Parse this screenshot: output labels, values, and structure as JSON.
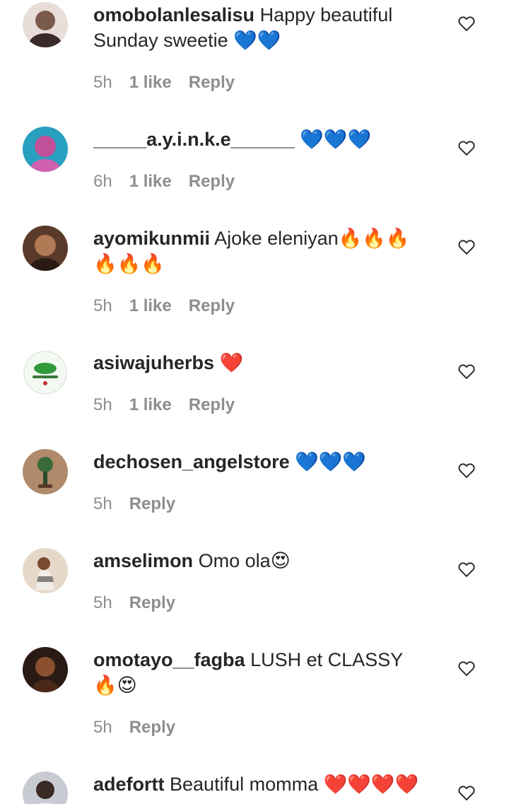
{
  "comments": [
    {
      "username": "omobolanlesalisu",
      "text": "Happy beautiful Sunday sweetie 💙💙",
      "time": "5h",
      "likes": "1 like",
      "reply": "Reply",
      "avatar_color": "#7a5a4a"
    },
    {
      "username": "_____a.y.i.n.k.e______",
      "text": "💙💙💙",
      "time": "6h",
      "likes": "1 like",
      "reply": "Reply",
      "avatar_color": "#c24f9a"
    },
    {
      "username": "ayomikunmii",
      "text": "Ajoke eleniyan🔥🔥🔥🔥🔥🔥",
      "time": "5h",
      "likes": "1 like",
      "reply": "Reply",
      "avatar_color": "#8a5a3a"
    },
    {
      "username": "asiwajuherbs",
      "text": "❤️",
      "time": "5h",
      "likes": "1 like",
      "reply": "Reply",
      "avatar_color": "#2f9a3a"
    },
    {
      "username": "dechosen_angelstore",
      "text": "💙💙💙",
      "time": "5h",
      "likes": "",
      "reply": "Reply",
      "avatar_color": "#9a7050"
    },
    {
      "username": "amselimon",
      "text": "Omo ola😍",
      "time": "5h",
      "likes": "",
      "reply": "Reply",
      "avatar_color": "#c8a888"
    },
    {
      "username": "omotayo__fagba",
      "text": "LUSH et CLASSY🔥😍",
      "time": "5h",
      "likes": "",
      "reply": "Reply",
      "avatar_color": "#5a3020"
    },
    {
      "username": "adefortt",
      "text": "Beautiful momma ❤️❤️❤️❤️",
      "time": "",
      "likes": "",
      "reply": "",
      "avatar_color": "#9aa0a8"
    }
  ],
  "icons": {
    "heart": "heart-outline-icon"
  },
  "colors": {
    "text": "#262626",
    "meta": "#8e8e8e"
  }
}
